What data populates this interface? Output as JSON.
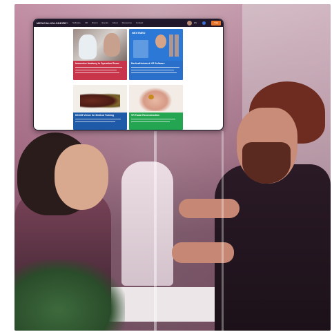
{
  "screenshot": {
    "nav": {
      "logo": "MEDICALHOLODECK",
      "items": [
        "Home",
        "Software",
        "VR",
        "Dicom",
        "Events",
        "About",
        "Resources",
        "Contact"
      ],
      "language": "EN",
      "cta": "Trial"
    },
    "tiles": [
      {
        "title": "Immersive Anatomy in Operation Room",
        "color": "#c8344a"
      },
      {
        "title": "MedicalHolodeck VR Software",
        "color": "#2a6fc9",
        "logo_text": "NEXTMED"
      },
      {
        "title": "DICOM Viewer for Medical Training",
        "color": "#1e5aa8"
      },
      {
        "title": "VR Facial Reconstruction",
        "color": "#23a552"
      }
    ]
  },
  "colors": {
    "nav_bg": "#21192b",
    "cta": "#e8762a",
    "photo_tint": "#b4467a"
  }
}
